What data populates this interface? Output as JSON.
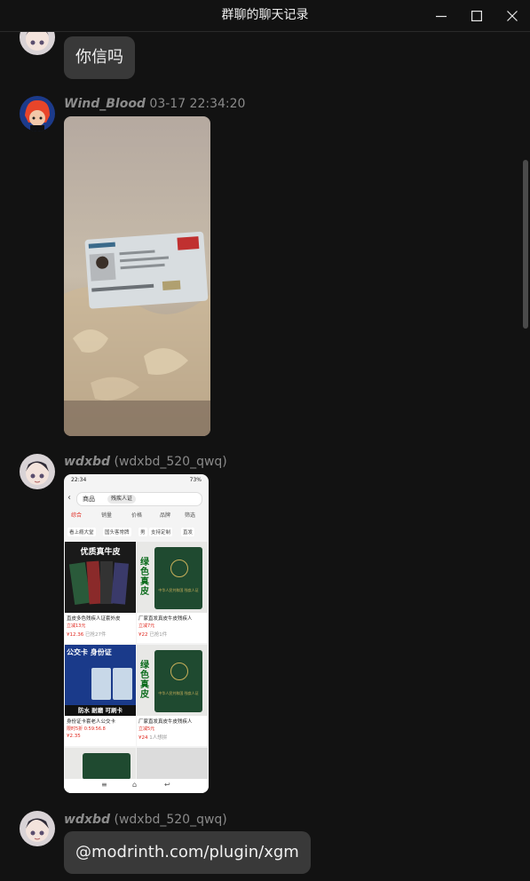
{
  "window": {
    "title": "群聊的聊天记录"
  },
  "messages": [
    {
      "type": "text",
      "text": "你信吗"
    },
    {
      "type": "image",
      "sender": {
        "nickname": "Wind_Blood",
        "timestamp": "03-17 22:34:20"
      }
    },
    {
      "type": "image",
      "sender": {
        "nickname": "wdxbd",
        "account": "(wdxbd_520_qwq)"
      },
      "phone_screenshot": {
        "status_time": "22:34",
        "status_right": "73%",
        "category": "商品",
        "search_chip": "残疾人证",
        "tabs": [
          "综合",
          "销量",
          "价格",
          "品牌",
          "筛选"
        ],
        "filters": [
          "看上瘾大堂",
          "国头客常牌",
          "男",
          "支持定制",
          "直发"
        ],
        "cards": [
          {
            "banner": "优质真牛皮",
            "title": "直皮多色残疾人证套外皮",
            "sub": "立减13元",
            "price": "¥12.36",
            "sold": "已抢27件"
          },
          {
            "side_text": "绿色真皮",
            "book_text": "中华人民共和国 残疾人证",
            "title": "厂家直发真皮牛皮残疾人",
            "sub": "立减7元",
            "price": "¥22",
            "sold": "已抢1件"
          },
          {
            "banner": "公交卡 身份证",
            "bottom": "防水 耐磨 可刷卡",
            "title": "身份证卡套老人公交卡",
            "sub": "限时5折 0:59:56.8",
            "price": "¥2.35",
            "sold": ""
          },
          {
            "side_text": "绿色真皮",
            "book_text": "中华人民共和国 残疾人证",
            "title": "厂家直发真皮牛皮残疾人",
            "sub": "立减5元",
            "price": "¥24",
            "sold": "1人想拼"
          }
        ]
      }
    },
    {
      "type": "text",
      "sender": {
        "nickname": "wdxbd",
        "account": "(wdxbd_520_qwq)"
      },
      "text": "@modrinth.com/plugin/xgm"
    }
  ],
  "colors": {
    "background": "#121212",
    "bubble": "#393939",
    "meta_text": "#8a8a8a"
  }
}
